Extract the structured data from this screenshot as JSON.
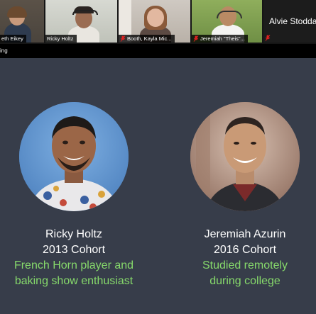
{
  "participants": [
    {
      "name": "Elizabeth Eikey",
      "visible_name": "eth Eikey",
      "muted": false
    },
    {
      "name": "Ricky Holtz",
      "visible_name": "Ricky Holtz",
      "muted": false
    },
    {
      "name": "Booth, Kayla Mic...",
      "visible_name": "Booth, Kayla Mic...",
      "muted": true
    },
    {
      "name": "Jeremiah \"Theis\"...",
      "visible_name": "Jeremiah \"Theis\"...",
      "muted": true
    },
    {
      "name": "Alvie Stoddard",
      "visible_name": "Alvie Stodda",
      "muted": true
    }
  ],
  "share_bar": {
    "text": "ing"
  },
  "slide": {
    "people": [
      {
        "name": "Ricky Holtz",
        "cohort": "2013 Cohort",
        "fact_line1": "French Horn player and",
        "fact_line2": "baking show enthusiast"
      },
      {
        "name": "Jeremiah Azurin",
        "cohort": "2016 Cohort",
        "fact_line1": "Studied remotely",
        "fact_line2": "during college"
      }
    ]
  },
  "colors": {
    "slide_background": "#373d4a",
    "fact_text": "#86d96b",
    "muted_icon": "#e02020"
  }
}
